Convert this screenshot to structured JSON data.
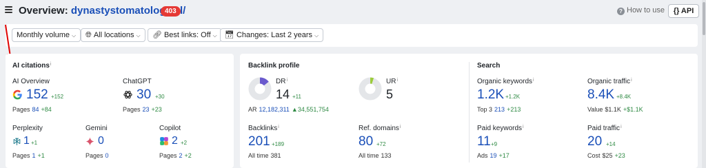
{
  "header": {
    "title_prefix": "Overview:",
    "domain": "dynastystomatology.pl/",
    "badge": "403",
    "how_to_use": "How to use",
    "api_label": "{} API"
  },
  "filters": [
    {
      "label": "Monthly volume"
    },
    {
      "label": "All locations"
    },
    {
      "label": "Best links: Off"
    },
    {
      "label": "Changes: Last 2 years"
    }
  ],
  "ai_citations": {
    "title": "AI citations",
    "info": "i",
    "ai_overview": {
      "label": "AI Overview",
      "value": "152",
      "delta": "+152",
      "pages_label": "Pages",
      "pages": "84",
      "pages_delta": "+84"
    },
    "chatgpt": {
      "label": "ChatGPT",
      "value": "30",
      "delta": "+30",
      "pages_label": "Pages",
      "pages": "23",
      "pages_delta": "+23"
    },
    "perplexity": {
      "label": "Perplexity",
      "value": "1",
      "delta": "+1",
      "pages_label": "Pages",
      "pages": "1",
      "pages_delta": "+1"
    },
    "gemini": {
      "label": "Gemini",
      "value": "0",
      "pages_label": "Pages",
      "pages": "0"
    },
    "copilot": {
      "label": "Copilot",
      "value": "2",
      "delta": "+2",
      "pages_label": "Pages",
      "pages": "2",
      "pages_delta": "+2"
    }
  },
  "backlink_profile": {
    "title": "Backlink profile",
    "dr": {
      "label": "DR",
      "value": "14",
      "delta": "+11",
      "progress": 0.14
    },
    "ur": {
      "label": "UR",
      "value": "5",
      "progress": 0.05
    },
    "ar": {
      "label": "AR",
      "value": "12,182,311",
      "delta": "34,551,754"
    },
    "backlinks": {
      "label": "Backlinks",
      "value": "201",
      "delta": "+189",
      "sub_label": "All time",
      "sub_value": "381"
    },
    "ref_domains": {
      "label": "Ref. domains",
      "value": "80",
      "delta": "+72",
      "sub_label": "All time",
      "sub_value": "133"
    }
  },
  "search": {
    "title": "Search",
    "organic_keywords": {
      "label": "Organic keywords",
      "value": "1.2K",
      "delta": "+1.2K",
      "sub_label": "Top 3",
      "sub_value": "213",
      "sub_delta": "+213"
    },
    "organic_traffic": {
      "label": "Organic traffic",
      "value": "8.4K",
      "delta": "+8.4K",
      "sub_label": "Value",
      "sub_value": "$1.1K",
      "sub_delta": "+$1.1K"
    },
    "paid_keywords": {
      "label": "Paid keywords",
      "value": "11",
      "delta": "+9",
      "sub_label": "Ads",
      "sub_value": "19",
      "sub_delta": "+17"
    },
    "paid_traffic": {
      "label": "Paid traffic",
      "value": "20",
      "delta": "+14",
      "sub_label": "Cost",
      "sub_value": "$25",
      "sub_delta": "+23"
    }
  },
  "colors": {
    "accent": "#1a4fb8",
    "positive": "#2f8a44",
    "badge": "#e53935",
    "dr_ring": "#6a5acd",
    "ur_ring": "#9ccc3c"
  }
}
